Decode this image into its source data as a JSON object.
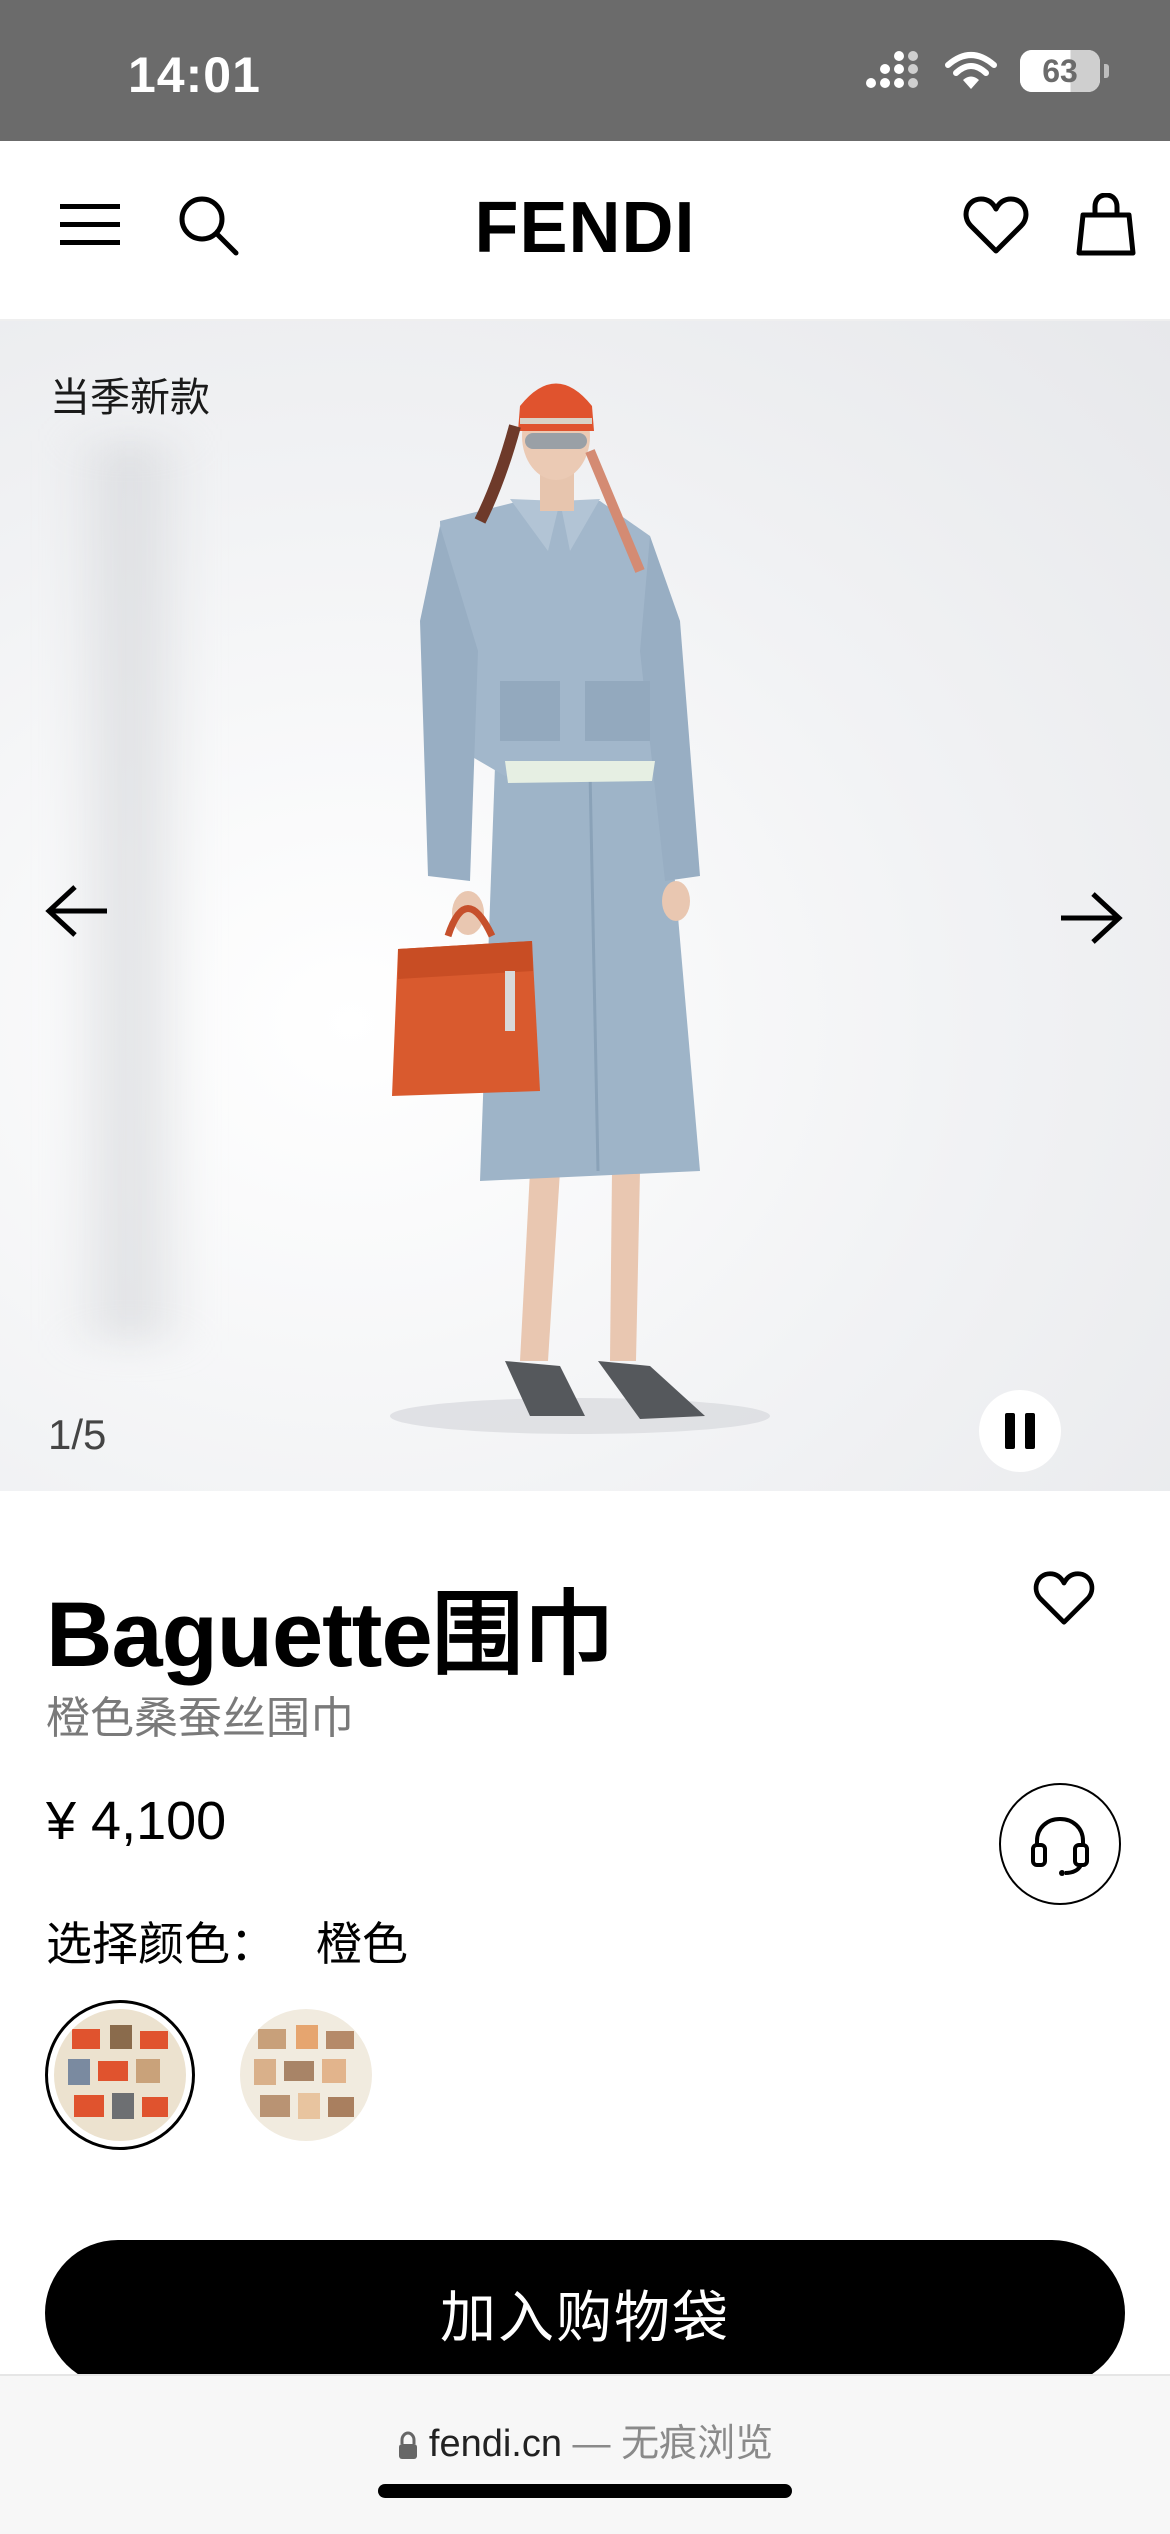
{
  "status_bar": {
    "time": "14:01",
    "battery": "63"
  },
  "header": {
    "brand": "FENDI"
  },
  "hero": {
    "tag": "当季新款",
    "counter": "1/5"
  },
  "product": {
    "title": "Baguette围巾",
    "subtitle": "橙色桑蚕丝围巾",
    "price": "¥ 4,100",
    "color_label": "选择颜色：",
    "color_value": "橙色"
  },
  "actions": {
    "add_to_bag": "加入购物袋"
  },
  "browser": {
    "url": "fendi.cn",
    "mode": "— 无痕浏览"
  },
  "colors": {
    "status_bar_bg": "#6b6b6b",
    "accent_orange": "#e0532e",
    "denim": "#9bb2c7"
  }
}
